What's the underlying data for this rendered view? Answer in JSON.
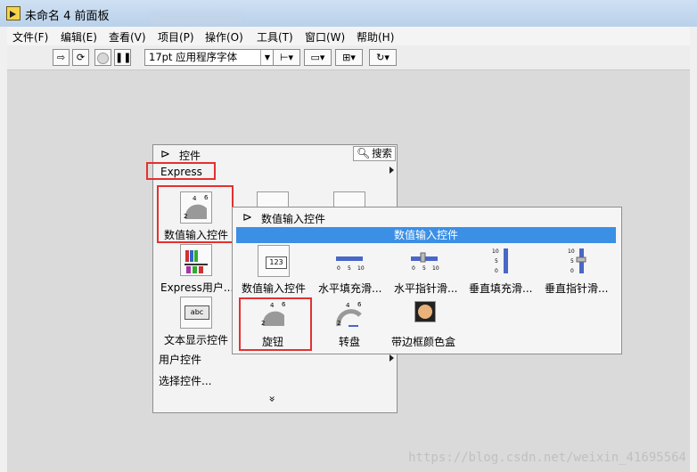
{
  "window": {
    "title": "未命名 4 前面板"
  },
  "menu": [
    "文件(F)",
    "编辑(E)",
    "查看(V)",
    "项目(P)",
    "操作(O)",
    "工具(T)",
    "窗口(W)",
    "帮助(H)"
  ],
  "toolbar": {
    "font": "17pt 应用程序字体"
  },
  "palette": {
    "title": "控件",
    "search": "搜索",
    "category": "Express",
    "items": [
      "数值输入控件",
      "Express用户...",
      "文本显示控件"
    ],
    "rows": [
      "用户控件",
      "选择控件..."
    ],
    "more": "»"
  },
  "submenu": {
    "title": "数值输入控件",
    "bar": "数值输入控件",
    "items": [
      "数值输入控件",
      "水平填充滑...",
      "水平指针滑...",
      "垂直填充滑...",
      "垂直指针滑...",
      "旋钮",
      "转盘",
      "带边框颜色盒"
    ]
  },
  "watermark": "https://blog.csdn.net/weixin_41695564"
}
